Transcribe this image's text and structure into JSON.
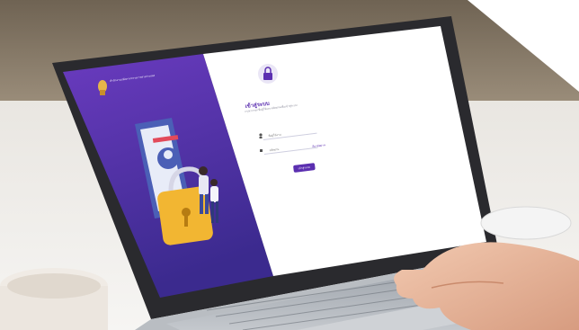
{
  "login": {
    "org_name": "สำนักงานปลัดกระทรวงการต่างประเทศ",
    "title": "เข้าสู่ระบบ",
    "subtitle": "กรุณากรอกชื่อผู้ใช้และรหัสผ่านเพื่อเข้าสู่ระบบ",
    "username_placeholder": "ชื่อผู้ใช้งาน",
    "password_placeholder": "รหัสผ่าน",
    "forgot_label": "ลืมรหัสผ่าน",
    "submit_label": "เข้าสู่ระบบ"
  },
  "colors": {
    "accent": "#5b2fb0",
    "sidebar_gradient_top": "#6a3bbf",
    "sidebar_gradient_bottom": "#3b2a8e",
    "shield": "#f2b632"
  }
}
